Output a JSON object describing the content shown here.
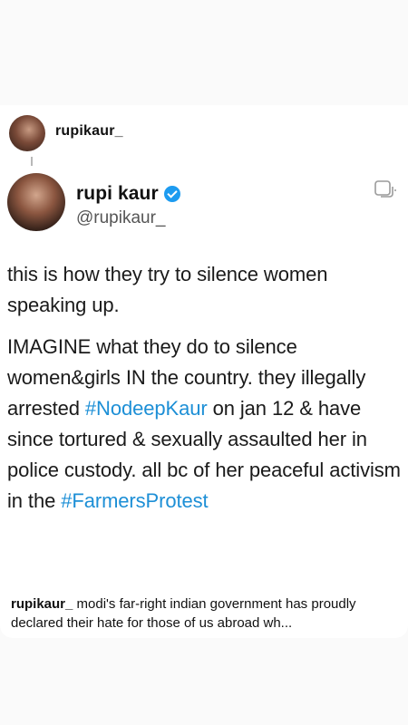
{
  "instagram": {
    "username": "rupikaur_"
  },
  "tweet": {
    "display_name": "rupi kaur",
    "handle": "@rupikaur_",
    "paragraph1": "this is how they try to silence women speaking up.",
    "p2_text1": "IMAGINE what they do to silence women&girls IN the country. they illegally arrested ",
    "p2_hashtag1": "#NodeepKaur",
    "p2_text2": " on jan 12 & have since tortured & sexually assaulted her in police custody. all bc of her peaceful activism in the ",
    "p2_hashtag2": "#FarmersProtest",
    "hashtag_color": "#1d8fd6",
    "verified_color": "#1d9bf0"
  },
  "caption": {
    "username": "rupikaur_",
    "text": "modi's far-right indian government has proudly declared their hate for those of us abroad wh..."
  },
  "icons": {
    "verified": "verified-badge-icon",
    "copy": "copy-icon"
  }
}
